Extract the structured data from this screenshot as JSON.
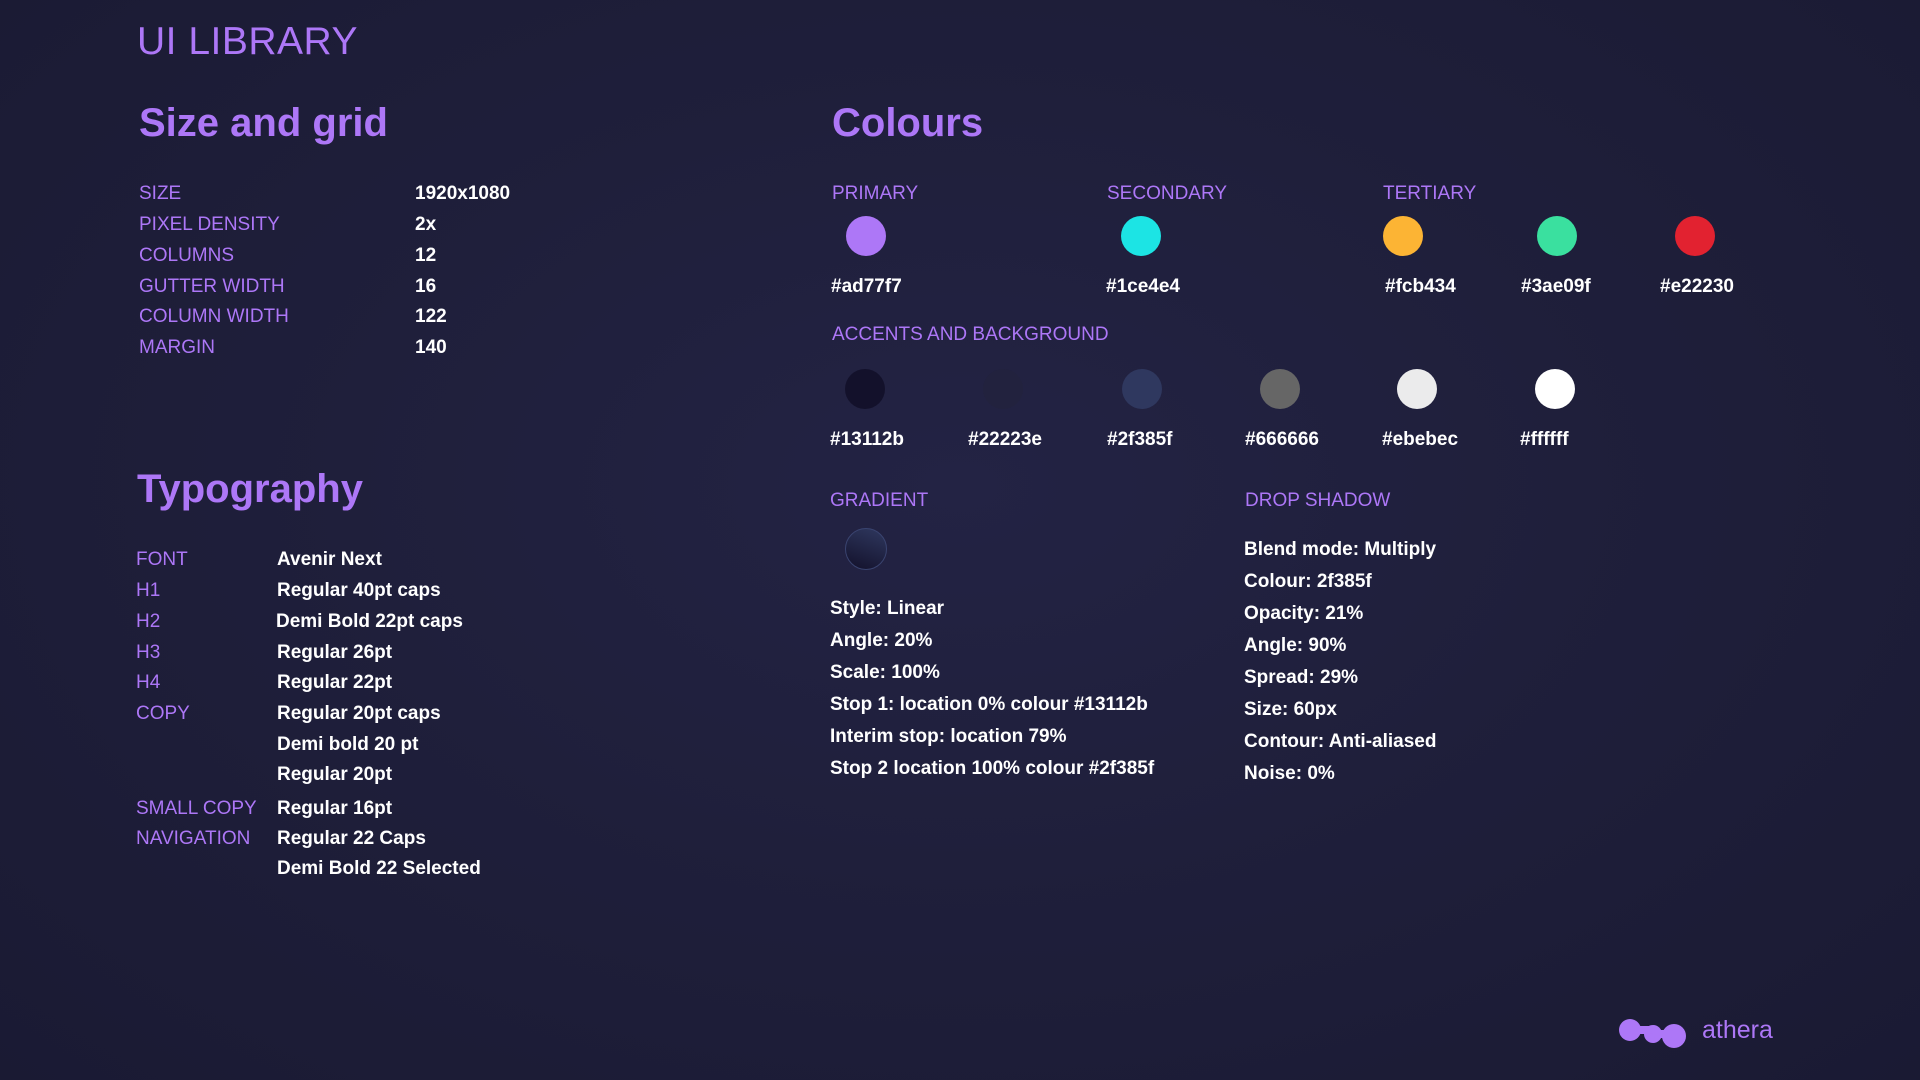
{
  "page": {
    "title": "UI LIBRARY"
  },
  "size_grid": {
    "heading": "Size and grid",
    "rows": [
      {
        "label": "SIZE",
        "value": "1920x1080"
      },
      {
        "label": "PIXEL DENSITY",
        "value": "2x"
      },
      {
        "label": "COLUMNS",
        "value": "12"
      },
      {
        "label": "GUTTER WIDTH",
        "value": "16"
      },
      {
        "label": "COLUMN WIDTH",
        "value": "122"
      },
      {
        "label": "MARGIN",
        "value": "140"
      }
    ]
  },
  "typography": {
    "heading": "Typography",
    "rows": [
      {
        "label": "FONT",
        "value": "Avenir Next"
      },
      {
        "label": "H1",
        "value": "Regular 40pt caps"
      },
      {
        "label": "H2",
        "value": "Demi Bold 22pt caps"
      },
      {
        "label": "H3",
        "value": "Regular 26pt"
      },
      {
        "label": "H4",
        "value": "Regular 22pt"
      },
      {
        "label": "COPY",
        "value": "Regular 20pt caps"
      },
      {
        "label": "",
        "value": "Demi bold 20 pt"
      },
      {
        "label": "",
        "value": "Regular 20pt"
      },
      {
        "label": "SMALL COPY",
        "value": "Regular 16pt"
      },
      {
        "label": "NAVIGATION",
        "value": "Regular 22 Caps"
      },
      {
        "label": "",
        "value": "Demi Bold 22 Selected"
      }
    ]
  },
  "colours": {
    "heading": "Colours",
    "primary_label": "PRIMARY",
    "secondary_label": "SECONDARY",
    "tertiary_label": "TERTIARY",
    "main_swatches": [
      {
        "hex": "#ad77f7",
        "color": "#ad77f7"
      },
      {
        "hex": "#1ce4e4",
        "color": "#1ce4e4"
      },
      {
        "hex": "#fcb434",
        "color": "#fcb434"
      },
      {
        "hex": "#3ae09f",
        "color": "#3ae09f"
      },
      {
        "hex": "#e22230",
        "color": "#e22230"
      }
    ],
    "accents_label": "ACCENTS AND BACKGROUND",
    "accent_swatches": [
      {
        "hex": "#13112b",
        "color": "#13112b"
      },
      {
        "hex": "#22223e",
        "color": "#22223e"
      },
      {
        "hex": "#2f385f",
        "color": "#2f385f"
      },
      {
        "hex": "#666666",
        "color": "#666666"
      },
      {
        "hex": "#ebebec",
        "color": "#ebebec"
      },
      {
        "hex": "#ffffff",
        "color": "#ffffff"
      }
    ]
  },
  "gradient": {
    "label": "GRADIENT",
    "from_color": "#13112b",
    "to_color": "#2f385f",
    "lines": [
      "Style: Linear",
      "Angle: 20%",
      "Scale: 100%",
      "Stop 1: location 0% colour #13112b",
      "Interim stop: location 79%",
      "Stop 2 location 100% colour #2f385f"
    ]
  },
  "drop_shadow": {
    "label": "DROP SHADOW",
    "lines": [
      "Blend mode: Multiply",
      "Colour: 2f385f",
      "Opacity: 21%",
      "Angle: 90%",
      "Spread: 29%",
      "Size: 60px",
      "Contour: Anti-aliased",
      "Noise: 0%"
    ]
  },
  "brand": {
    "name": "athera",
    "color": "#ad77f7"
  }
}
